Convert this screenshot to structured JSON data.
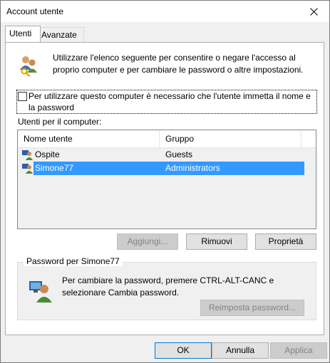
{
  "window": {
    "title": "Account utente"
  },
  "tabs": [
    {
      "label": "Utenti"
    },
    {
      "label": "Avanzate"
    }
  ],
  "intro": {
    "text": "Utilizzare l'elenco seguente per consentire o negare l'accesso al proprio computer e per cambiare le password o altre impostazioni."
  },
  "require_login": {
    "label": "Per utilizzare questo computer è necessario che l'utente immetta il nome e la password",
    "checked": false
  },
  "users_section": {
    "label": "Utenti per il computer:",
    "columns": [
      "Nome utente",
      "Gruppo"
    ],
    "rows": [
      {
        "name": "Ospite",
        "group": "Guests",
        "selected": false
      },
      {
        "name": "Simone77",
        "group": "Administrators",
        "selected": true
      }
    ]
  },
  "list_buttons": {
    "add": "Aggiungi...",
    "remove": "Rimuovi",
    "properties": "Proprietà"
  },
  "password_group": {
    "title": "Password per Simone77",
    "text": "Per cambiare la password, premere CTRL-ALT-CANC e selezionare Cambia password.",
    "reset_button": "Reimposta password..."
  },
  "footer": {
    "ok": "OK",
    "cancel": "Annulla",
    "apply": "Applica"
  }
}
